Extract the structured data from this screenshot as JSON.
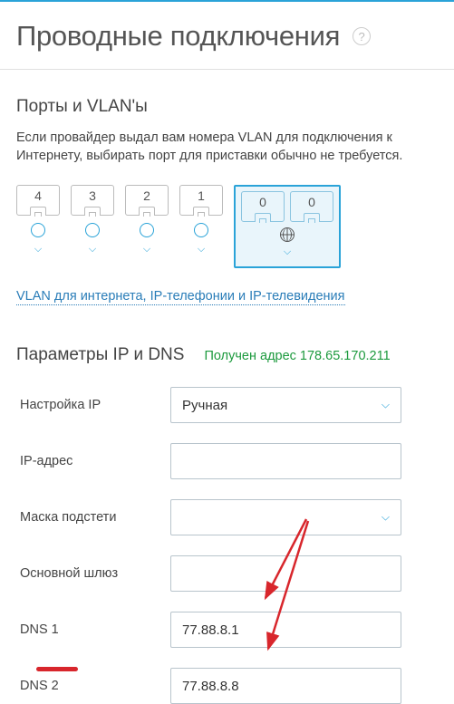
{
  "header": {
    "title": "Проводные подключения"
  },
  "ports_section": {
    "heading": "Порты и VLAN'ы",
    "description": "Если провайдер выдал вам номера VLAN для подключения к Интернету, выбирать порт для приставки обычно не требуется.",
    "ports": [
      "4",
      "3",
      "2",
      "1"
    ],
    "wan_ports": [
      "0",
      "0"
    ],
    "vlan_link": "VLAN для интернета, IP-телефонии и IP-телевидения"
  },
  "ip_section": {
    "heading": "Параметры IP и DNS",
    "status": "Получен адрес 178.65.170.211",
    "labels": {
      "ip_mode": "Настройка IP",
      "ip_address": "IP-адрес",
      "subnet": "Маска подстети",
      "gateway": "Основной шлюз",
      "dns1": "DNS 1",
      "dns2": "DNS 2"
    },
    "values": {
      "ip_mode": "Ручная",
      "ip_address": "",
      "subnet": "",
      "gateway": "",
      "dns1": "77.88.8.1",
      "dns2": "77.88.8.8"
    }
  }
}
